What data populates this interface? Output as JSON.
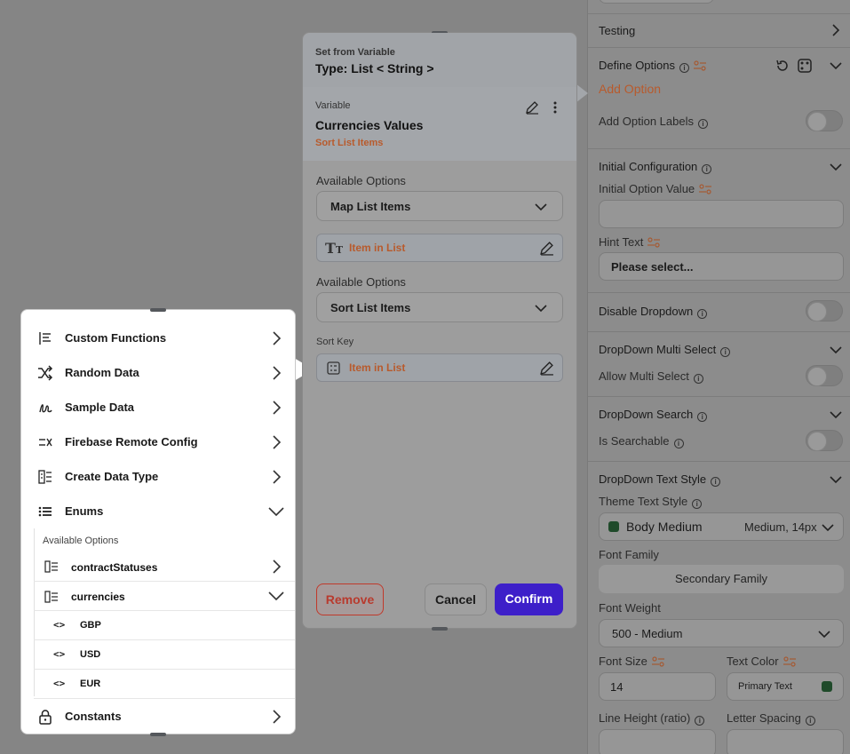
{
  "props": {
    "testing": "Testing",
    "define_options": "Define Options",
    "add_option": "Add Option",
    "add_option_labels": "Add Option Labels",
    "initial_configuration": "Initial Configuration",
    "initial_option_value": "Initial Option Value",
    "hint_text": "Hint Text",
    "hint_text_value": "Please select...",
    "disable_dropdown": "Disable Dropdown",
    "multi_select_section": "DropDown Multi Select",
    "allow_multi_select": "Allow Multi Select",
    "search_section": "DropDown Search",
    "is_searchable": "Is Searchable",
    "text_style_section": "DropDown Text Style",
    "theme_text_style": "Theme Text Style",
    "theme_text_style_value": "Body Medium",
    "theme_text_style_detail": "Medium, 14px",
    "theme_text_style_color": "#1f4a2a",
    "font_family": "Font Family",
    "font_family_value": "Secondary Family",
    "font_weight": "Font Weight",
    "font_weight_value": "500 - Medium",
    "font_size": "Font Size",
    "font_size_value": "14",
    "text_color": "Text Color",
    "text_color_value": "Primary Text",
    "text_color_swatch": "#1f4a2a",
    "line_height": "Line Height (ratio)",
    "letter_spacing": "Letter Spacing",
    "accent": "#b85a2c"
  },
  "dialog": {
    "header_small": "Set from Variable",
    "header_type": "Type: List < String >",
    "variable_label": "Variable",
    "variable_name": "Currencies Values",
    "variable_action": "Sort List Items",
    "available_options_1": "Available Options",
    "dropdown_1": "Map List Items",
    "item_1": "Item in List",
    "available_options_2": "Available Options",
    "dropdown_2": "Sort List Items",
    "sort_key_label": "Sort Key",
    "sort_key_value": "Item in List",
    "remove": "Remove",
    "cancel": "Cancel",
    "confirm": "Confirm",
    "confirm_color": "#3d1fc9",
    "remove_color": "#c0392b"
  },
  "menu": {
    "items": [
      {
        "label": "Custom Functions",
        "icon": "custom-functions-icon"
      },
      {
        "label": "Random Data",
        "icon": "shuffle-icon"
      },
      {
        "label": "Sample Data",
        "icon": "sample-data-icon"
      },
      {
        "label": "Firebase Remote Config",
        "icon": "remote-config-icon"
      },
      {
        "label": "Create Data Type",
        "icon": "data-type-icon"
      },
      {
        "label": "Enums",
        "icon": "list-icon"
      }
    ],
    "enums_available_options": "Available Options",
    "enums": [
      {
        "label": "contractStatuses"
      },
      {
        "label": "currencies"
      }
    ],
    "currency_values": [
      "GBP",
      "USD",
      "EUR"
    ],
    "constants": "Constants"
  }
}
